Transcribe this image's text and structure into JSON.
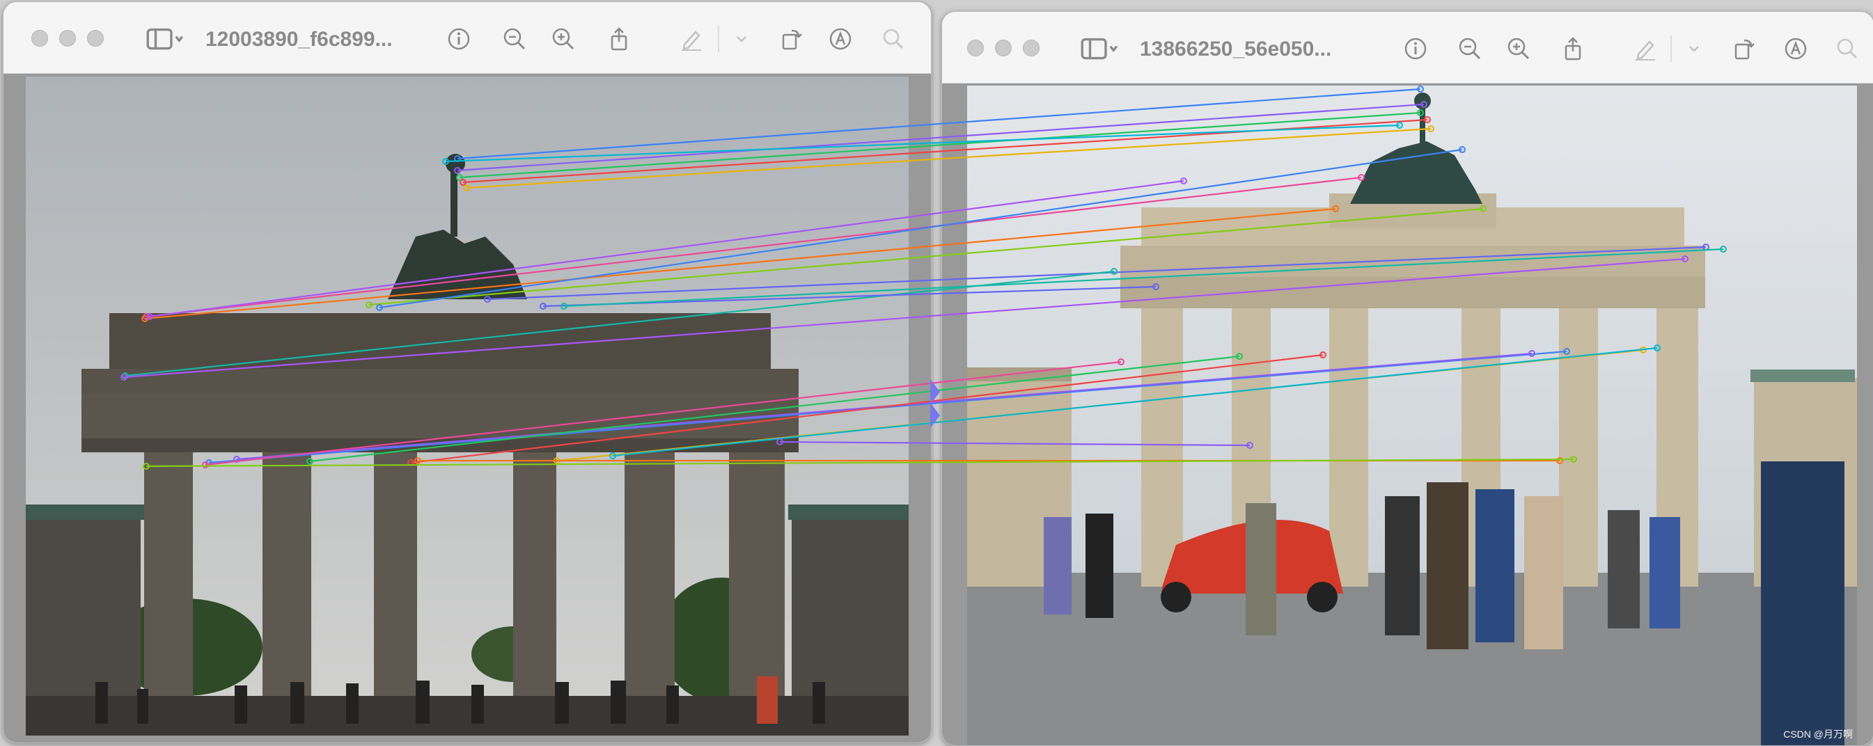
{
  "left_window": {
    "title": "12003890_f6c899...",
    "toolbar": {
      "sidebar_icon": "sidebar-toggle-icon",
      "info_icon": "info-icon",
      "zoom_out_icon": "zoom-out-icon",
      "zoom_in_icon": "zoom-in-icon",
      "share_icon": "share-icon",
      "markup_icon": "markup-pen-icon",
      "rotate_icon": "rotate-icon",
      "annotate_icon": "annotate-icon",
      "search_icon": "search-icon"
    }
  },
  "right_window": {
    "title": "13866250_56e050...",
    "toolbar": {
      "sidebar_icon": "sidebar-toggle-icon",
      "info_icon": "info-icon",
      "zoom_out_icon": "zoom-out-icon",
      "zoom_in_icon": "zoom-in-icon",
      "share_icon": "share-icon",
      "markup_icon": "markup-pen-icon",
      "rotate_icon": "rotate-icon",
      "annotate_icon": "annotate-icon",
      "search_icon": "search-icon"
    },
    "watermark": "CSDN @月万啊"
  },
  "matches": {
    "colors": [
      "#3b82f6",
      "#8b5cf6",
      "#22c55e",
      "#ef4444",
      "#eab308",
      "#06b6d4",
      "#ec4899",
      "#f97316",
      "#84cc16",
      "#6366f1",
      "#14b8a6",
      "#a855f7"
    ]
  }
}
